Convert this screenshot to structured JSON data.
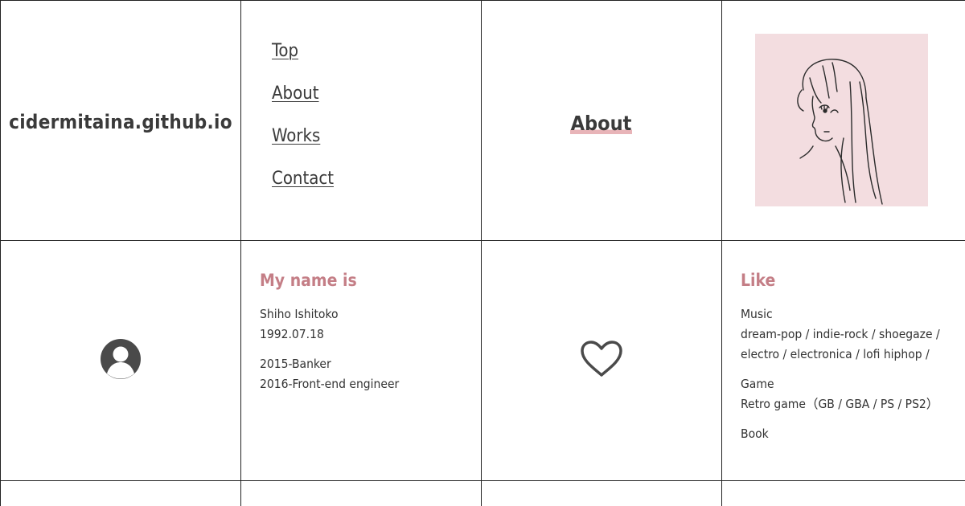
{
  "site": {
    "title": "cidermitaina.github.io"
  },
  "nav": {
    "items": [
      {
        "label": "Top"
      },
      {
        "label": "About"
      },
      {
        "label": "Works"
      },
      {
        "label": "Contact"
      }
    ]
  },
  "section": {
    "heading": "About",
    "highlight_color": "#e8b4b8"
  },
  "profile": {
    "icon": "user-circle-icon",
    "heading": "My name is",
    "name": "Shiho Ishitoko",
    "birthday": "1992.07.18",
    "career": [
      "2015-Banker",
      "2016-Front-end engineer"
    ]
  },
  "likes": {
    "icon": "heart-icon",
    "heading": "Like",
    "music_label": "Music",
    "music_line1": "dream-pop / indie-rock / shoegaze /",
    "music_line2": "electro / electronica / lofi hiphop /",
    "game_label": "Game",
    "game_value": "Retro game（GB / GBA / PS / PS2）",
    "book_label": "Book"
  },
  "colors": {
    "accent": "#c47e86",
    "illustration_bg": "#f3dde0",
    "border": "#222222",
    "text": "#3a3a3a"
  }
}
